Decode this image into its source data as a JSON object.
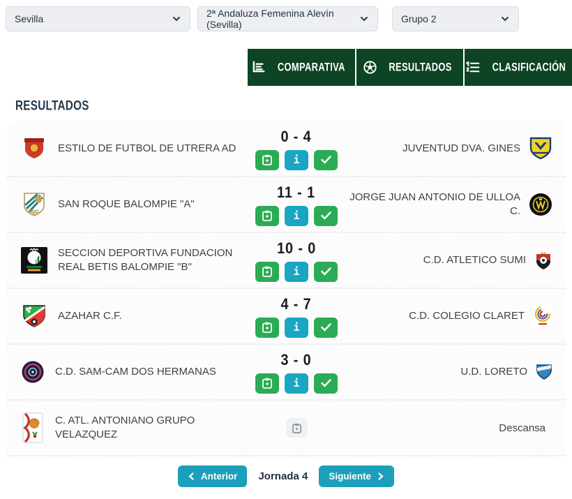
{
  "filters": {
    "territorial": {
      "value": "Sevilla"
    },
    "competition": {
      "value": "2ª Andaluza Femenina Alevín (Sevilla)"
    },
    "group": {
      "value": "Grupo 2"
    }
  },
  "tabs": {
    "comparativa": "COMPARATIVA",
    "resultados": "RESULTADOS",
    "clasificacion": "CLASIFICACIÓN"
  },
  "section": {
    "title": "RESULTADOS"
  },
  "icons": {
    "info": "i"
  },
  "matches": [
    {
      "home": "ESTILO DE FUTBOL DE UTRERA AD",
      "score": "0 - 4",
      "away": "JUVENTUD DVA. GINES"
    },
    {
      "home": "SAN ROQUE BALOMPIE \"A\"",
      "score": "11 - 1",
      "away": "JORGE JUAN ANTONIO DE ULLOA C."
    },
    {
      "home": "SECCION DEPORTIVA FUNDACION REAL BETIS BALOMPIE \"B\"",
      "score": "10 - 0",
      "away": "C.D. ATLETICO SUMI"
    },
    {
      "home": "AZAHAR C.F.",
      "score": "4 - 7",
      "away": "C.D. COLEGIO CLARET"
    },
    {
      "home": "C.D. SAM-CAM DOS HERMANAS",
      "score": "3 - 0",
      "away": "U.D. LORETO"
    },
    {
      "home": "C. ATL. ANTONIANO GRUPO VELAZQUEZ",
      "score": "",
      "away": "",
      "status": "Descansa"
    }
  ],
  "pagination": {
    "prev": "Anterior",
    "current": "Jornada 4",
    "next": "Siguiente"
  },
  "colors": {
    "tab_green": "#0d4423",
    "button_green": "#2cab55",
    "button_teal": "#1aa6c2",
    "pagination_teal": "#1b9fba"
  }
}
